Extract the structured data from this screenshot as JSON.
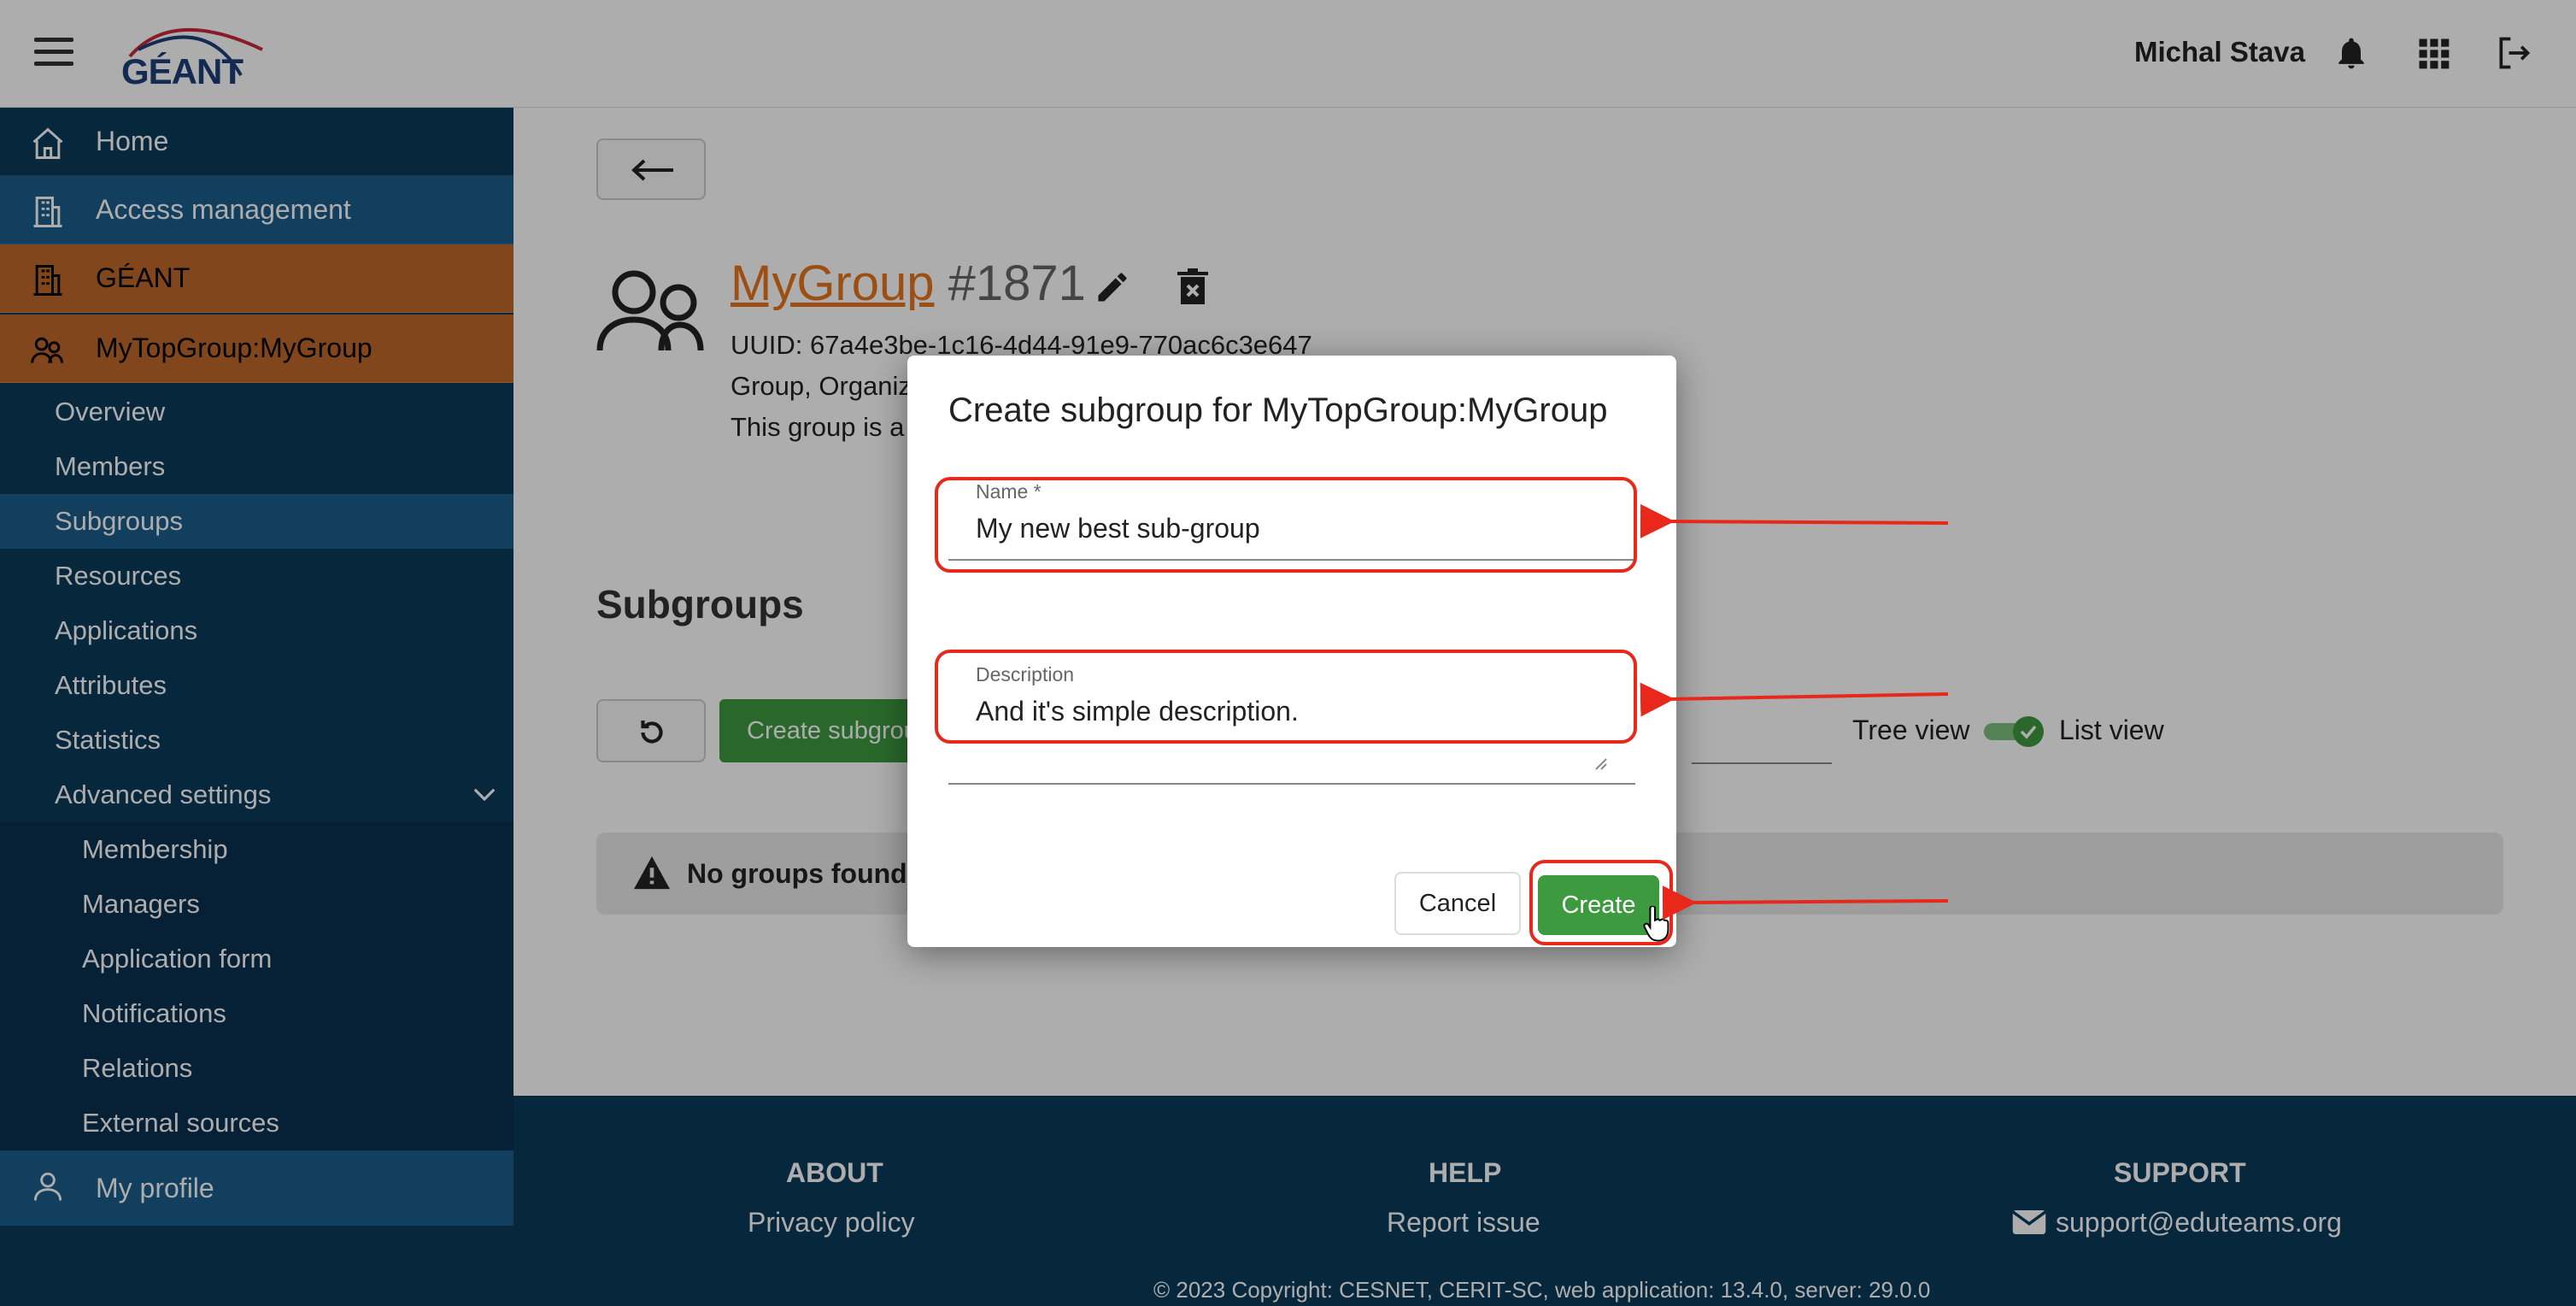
{
  "header": {
    "logo_text": "GÉANT",
    "user_name": "Michal Stava",
    "icons": [
      "menu-icon",
      "bell-icon",
      "apps-grid-icon",
      "logout-icon"
    ]
  },
  "sidebar": {
    "top_items": [
      {
        "label": "Home",
        "icon": "home-icon"
      },
      {
        "label": "Access management",
        "icon": "building-icon"
      },
      {
        "label": "GÉANT",
        "icon": "building-icon"
      },
      {
        "label": "MyTopGroup:MyGroup",
        "icon": "group-icon"
      }
    ],
    "sub_items": [
      "Overview",
      "Members",
      "Subgroups",
      "Resources",
      "Applications",
      "Attributes",
      "Statistics",
      "Advanced settings"
    ],
    "advanced_items": [
      "Membership",
      "Managers",
      "Application form",
      "Notifications",
      "Relations",
      "External sources"
    ],
    "profile_label": "My profile"
  },
  "group": {
    "name": "MyGroup",
    "id": "#1871",
    "uuid": "UUID: 67a4e3be-1c16-4d44-91e9-770ac6c3e647",
    "type_line": "Group, Organiz",
    "note_line": "This group is a"
  },
  "subgroups": {
    "heading": "Subgroups",
    "create_button": "Create subgrou",
    "tree_view": "Tree view",
    "list_view": "List view",
    "empty_message": "No groups found"
  },
  "dialog": {
    "title": "Create subgroup for MyTopGroup:MyGroup",
    "name_label": "Name *",
    "name_value": "My new best sub-group",
    "description_label": "Description",
    "description_value": "And it's simple description.",
    "cancel": "Cancel",
    "create": "Create"
  },
  "footer": {
    "about": "ABOUT",
    "privacy": "Privacy policy",
    "help": "HELP",
    "report": "Report issue",
    "support": "SUPPORT",
    "email": "support@eduteams.org",
    "copyright": "© 2023 Copyright: CESNET, CERIT-SC, web application: 13.4.0, server: 29.0.0"
  },
  "colors": {
    "sidebar": "#0b3a5a",
    "sidebar_active": "#1a5d8a",
    "orange": "#c0682a",
    "accent_green": "#3d9a3f",
    "annotation_red": "#e8281a",
    "link_orange": "#e8741c"
  }
}
